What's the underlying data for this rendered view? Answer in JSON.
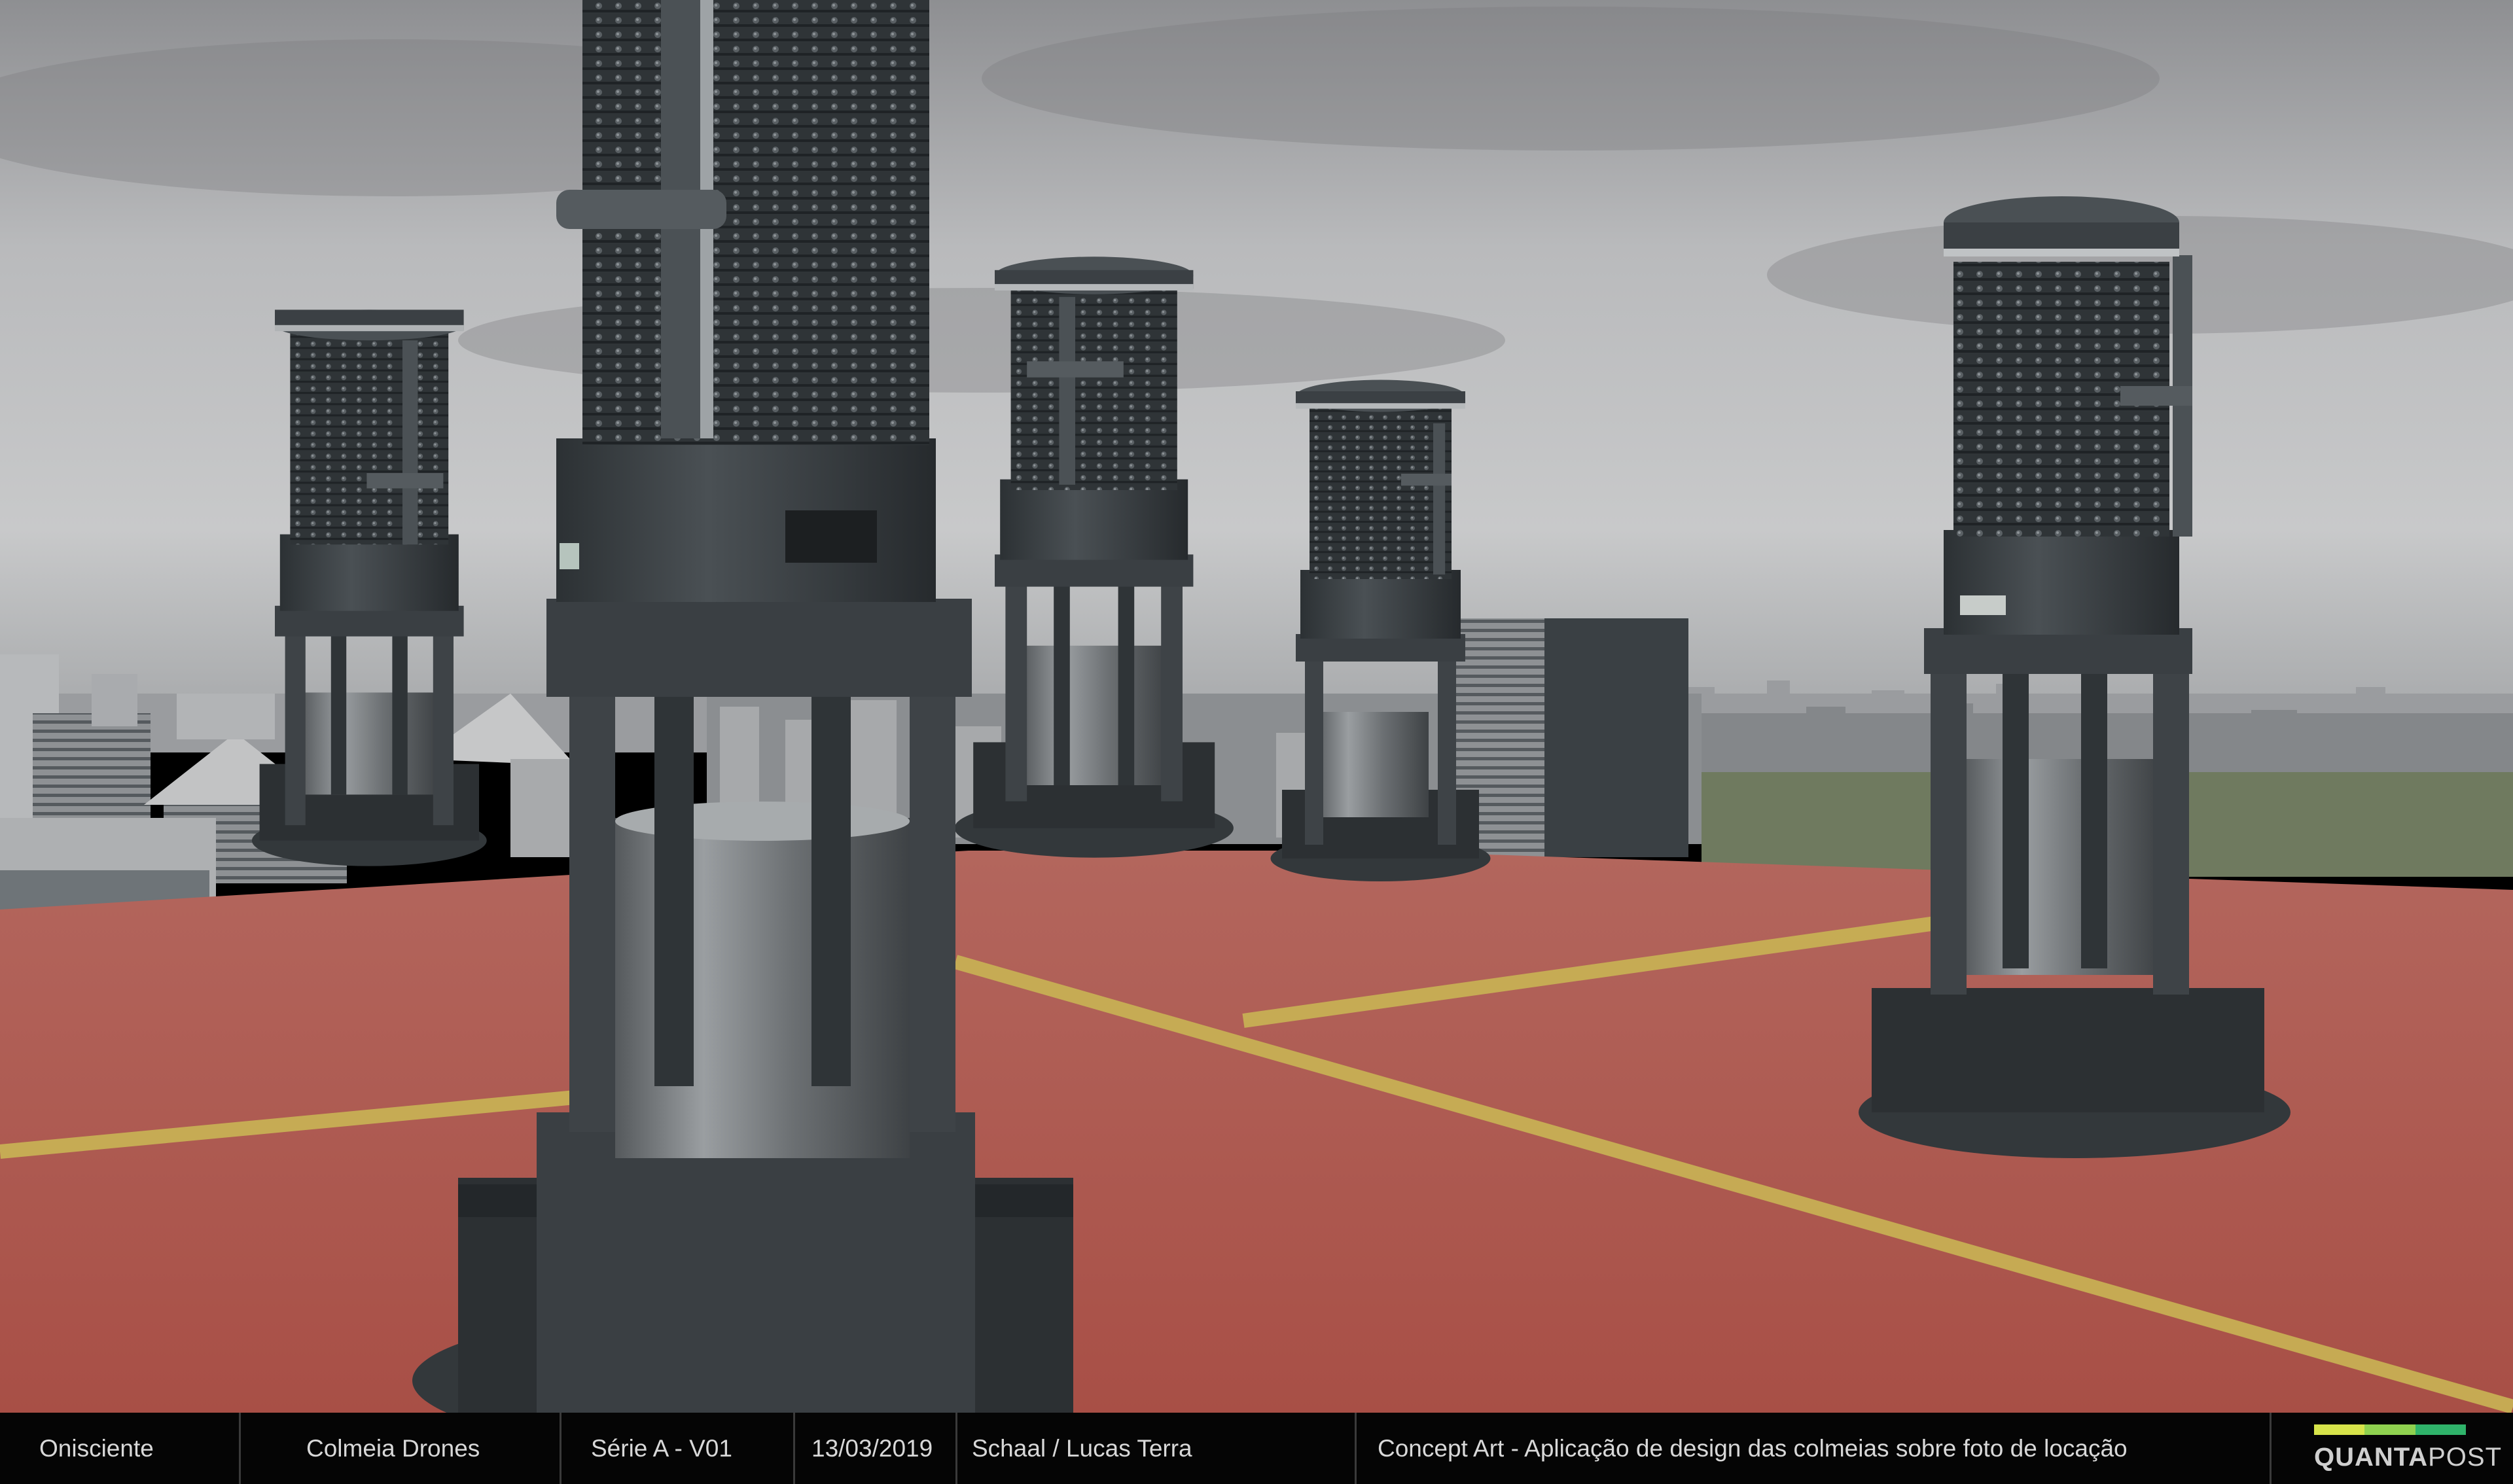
{
  "caption": {
    "project": "Onisciente",
    "subject": "Colmeia Drones",
    "series": "Série A - V01",
    "date": "13/03/2019",
    "authors": "Schaal / Lucas Terra",
    "description": "Concept Art - Aplicação de design das colmeias sobre foto de locação"
  },
  "logo": {
    "word_a": "QUANTA",
    "word_b": "POST",
    "bar_colors": [
      "#d7e34a",
      "#8fd14f",
      "#2fb36a"
    ]
  },
  "colors": {
    "sky": "#b4b5b7",
    "roof": "#b0574d",
    "roof_line": "#c9b454",
    "tower": "#3a3f43",
    "canister": "#7b8083"
  }
}
